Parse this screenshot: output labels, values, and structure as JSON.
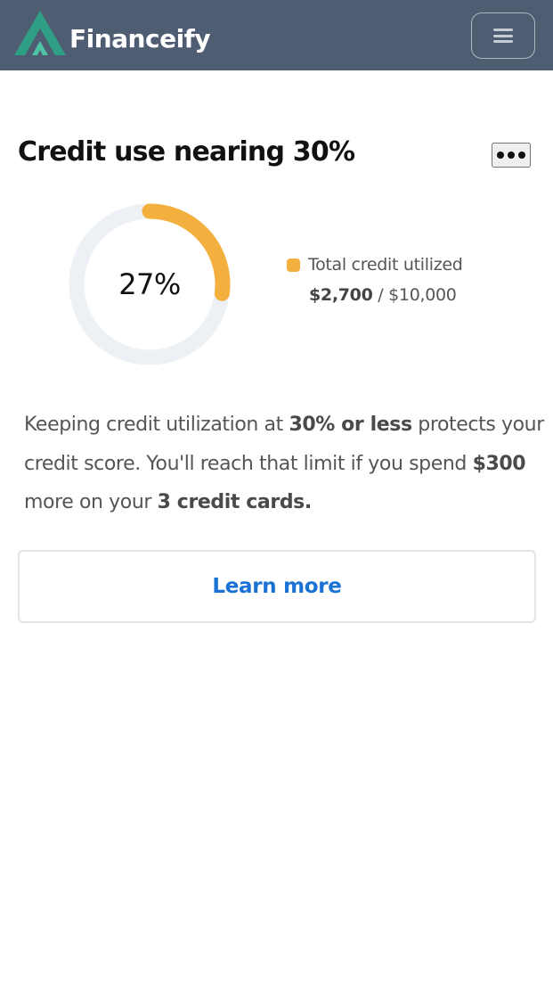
{
  "header": {
    "brand": "Financeify",
    "colors": {
      "bar": "#4f5d73",
      "logo_dark": "#2f9e85",
      "logo_light": "#4fc4a4"
    },
    "menu_icon": "hamburger-menu-icon"
  },
  "card": {
    "title": "Credit use nearing 30%",
    "more_icon": "ellipsis-icon",
    "utilization": {
      "percent_label": "27%",
      "fraction": 0.27,
      "color": "#f4b03f",
      "track_color": "#edf1f6"
    },
    "legend": {
      "label": "Total credit utilized",
      "used": "$2,700",
      "separator": " / ",
      "limit": "$10,000"
    },
    "description": {
      "p1": "Keeping credit utilization at ",
      "b1": "30% or less",
      "p2": " protects your credit score. You'll reach that limit if you spend ",
      "b2": "$300",
      "p3": " more on your ",
      "b3": "3 credit cards."
    },
    "cta_label": "Learn more"
  }
}
